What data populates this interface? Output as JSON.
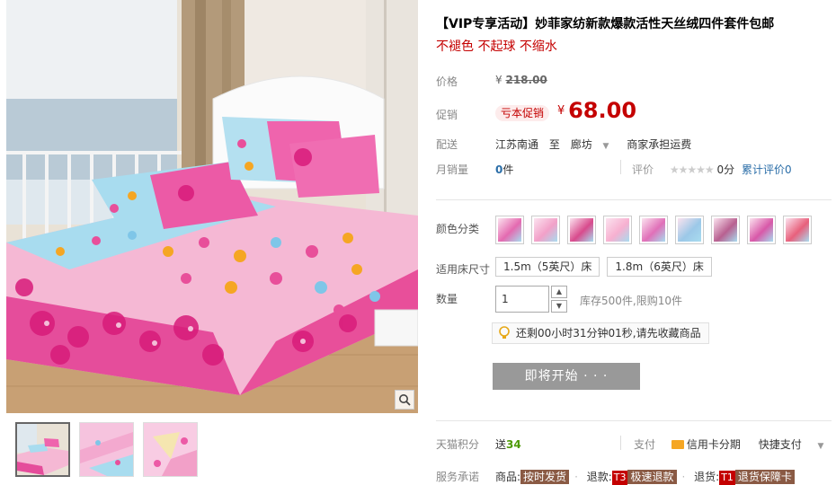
{
  "gallery": {
    "zoom_icon": "magnifier-icon",
    "thumbnails": [
      "thumb-bed",
      "thumb-fabric",
      "thumb-fold"
    ]
  },
  "product": {
    "title": "【VIP专享活动】妙菲家纺新款爆款活性天丝绒四件套件包邮",
    "subtitle": "不褪色 不起球 不缩水"
  },
  "price": {
    "label": "价格",
    "currency": "¥",
    "original": "218.00"
  },
  "promo": {
    "label": "促销",
    "tag": "亏本促销",
    "currency": "¥",
    "price": "68.00"
  },
  "shipping": {
    "label": "配送",
    "from": "江苏南通",
    "to_word": "至",
    "to": "廊坊",
    "fee": "商家承担运费"
  },
  "sales": {
    "label": "月销量",
    "count": "0",
    "unit": "件",
    "rating_label": "评价",
    "stars": "★★★★★",
    "score": "0分",
    "review_link": "累计评价0"
  },
  "options": {
    "color_label": "颜色分类",
    "colors": [
      "#e46ab0",
      "#f2a0c8",
      "#d84a8c",
      "#f7b0d0",
      "#e070b8",
      "#9cc8e8",
      "#b86090",
      "#d858a8",
      "#e8607c"
    ],
    "size_label": "适用床尺寸",
    "sizes": [
      "1.5m（5英尺）床",
      "1.8m（6英尺）床"
    ],
    "quantity_label": "数量",
    "quantity_value": "1",
    "stock_text": "库存500件,限购10件"
  },
  "countdown": {
    "text": "还剩00小时31分钟01秒,请先收藏商品"
  },
  "action": {
    "start_label": "即将开始 · · ·"
  },
  "footer": {
    "points_label": "天猫积分",
    "points_prefix": "送",
    "points_value": "34",
    "pay_label": "支付",
    "pay_card": "信用卡分期",
    "pay_quick": "快捷支付",
    "service_label": "服务承诺",
    "goods_label": "商品:",
    "goods_tag": "按时发货",
    "refund_label": "退款:",
    "refund_code": "T3",
    "refund_tag": "极速退款",
    "return_label": "退货:",
    "return_code": "T1",
    "return_tag": "退货保障卡"
  }
}
